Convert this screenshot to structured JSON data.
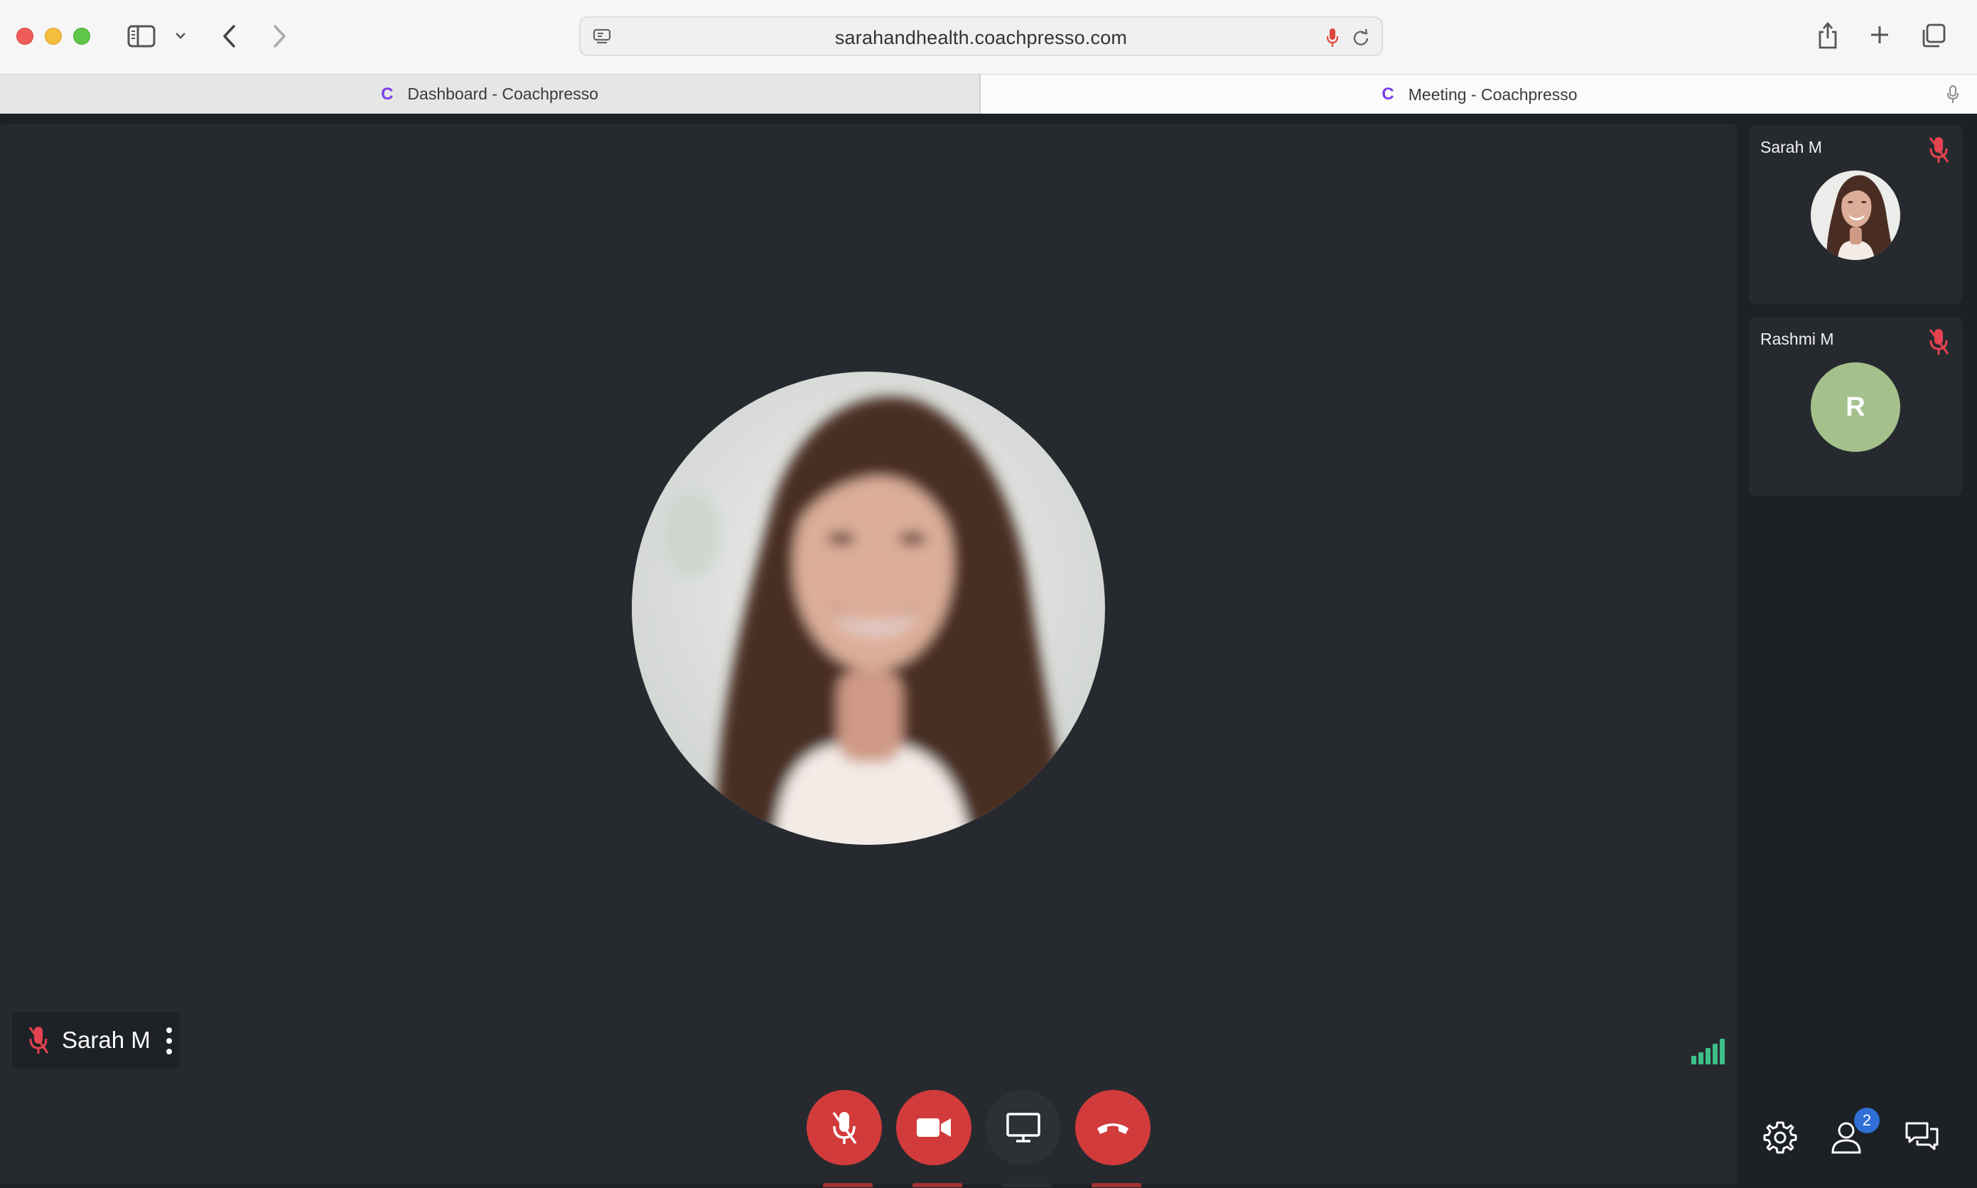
{
  "browser": {
    "url": "sarahandhealth.coachpresso.com",
    "tabs": [
      {
        "favicon": "C",
        "label": "Dashboard - Coachpresso",
        "active": false
      },
      {
        "favicon": "C",
        "label": "Meeting - Coachpresso",
        "active": true
      }
    ],
    "icons": [
      "sidebar-icon",
      "chevron-down-icon",
      "back-icon",
      "forward-icon",
      "reader-icon",
      "microphone-icon",
      "reload-icon",
      "share-icon",
      "plus-icon",
      "tabs-overview-icon"
    ],
    "colors": {
      "mic_accent": "#e0443c",
      "favicon": "#7a3ee8"
    }
  },
  "meeting": {
    "active_speaker": {
      "name": "Sarah M",
      "muted": true
    },
    "participants": [
      {
        "name": "Sarah M",
        "avatar": "photo",
        "muted": true
      },
      {
        "name": "Rashmi M",
        "initial": "R",
        "avatar_color": "#a4c18c",
        "muted": true
      }
    ],
    "participant_count": "2",
    "controls": [
      "mic-off-icon",
      "camera-off-icon",
      "screen-share-icon",
      "end-call-icon"
    ],
    "toolbar_right": [
      "settings-icon",
      "participants-icon",
      "chat-icon"
    ],
    "colors": {
      "control_red": "#d23b3b",
      "muted_red": "#e5434f",
      "signal_green": "#3dbf8a",
      "badge_blue": "#2f6fd6"
    }
  }
}
